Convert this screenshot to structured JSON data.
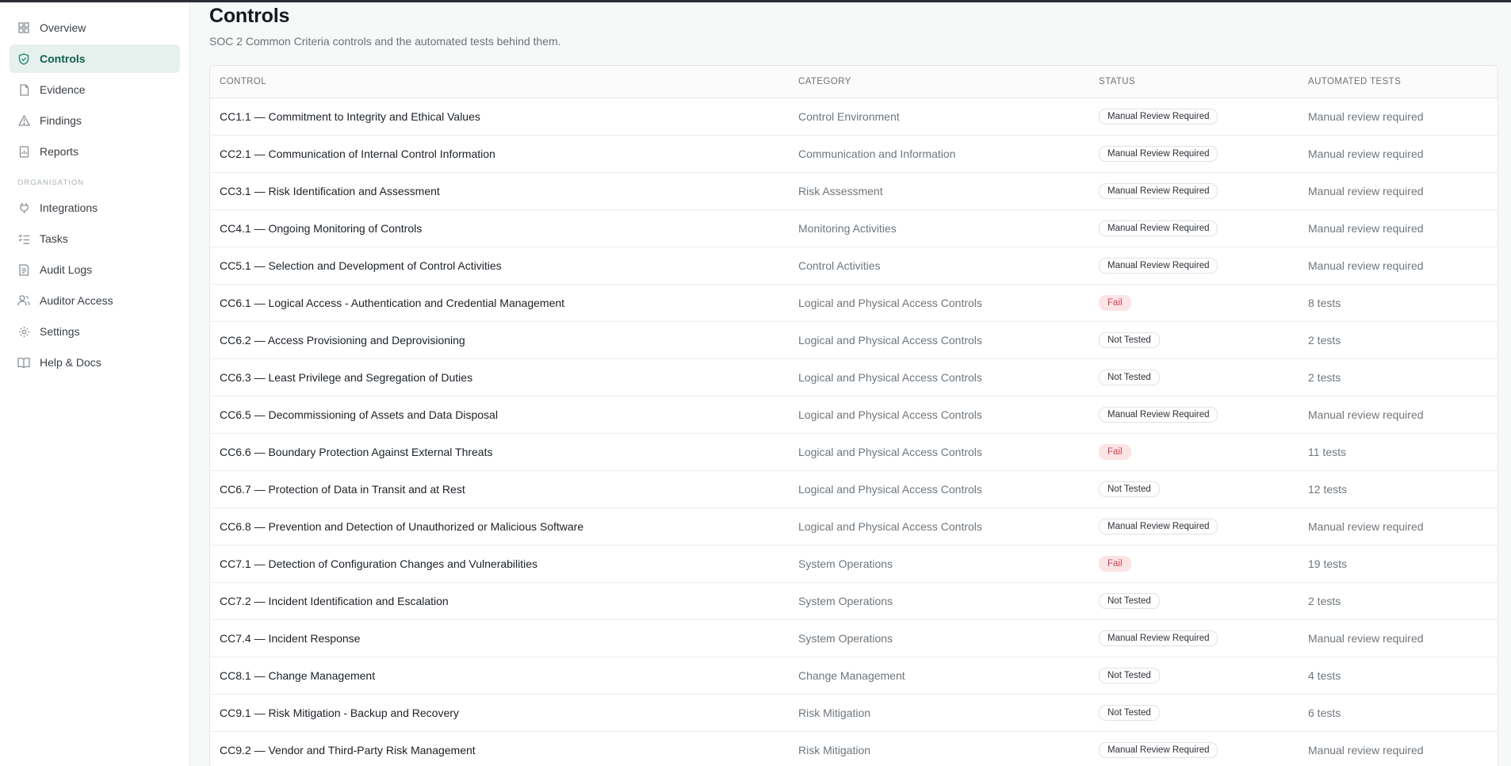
{
  "sidebar": {
    "items": [
      {
        "label": "Overview",
        "icon": "grid-icon"
      },
      {
        "label": "Controls",
        "icon": "shield-check-icon",
        "active": true
      },
      {
        "label": "Evidence",
        "icon": "file-icon"
      },
      {
        "label": "Findings",
        "icon": "alert-triangle-icon"
      },
      {
        "label": "Reports",
        "icon": "report-icon"
      }
    ],
    "section_label": "ORGANISATION",
    "org_items": [
      {
        "label": "Integrations",
        "icon": "plug-icon"
      },
      {
        "label": "Tasks",
        "icon": "list-check-icon"
      },
      {
        "label": "Audit Logs",
        "icon": "log-icon"
      },
      {
        "label": "Auditor Access",
        "icon": "users-icon"
      },
      {
        "label": "Settings",
        "icon": "gear-icon"
      },
      {
        "label": "Help & Docs",
        "icon": "book-icon"
      }
    ]
  },
  "page": {
    "title": "Controls",
    "subtitle": "SOC 2 Common Criteria controls and the automated tests behind them."
  },
  "table": {
    "headers": [
      "CONTROL",
      "CATEGORY",
      "STATUS",
      "AUTOMATED TESTS"
    ],
    "rows": [
      {
        "control": "CC1.1 — Commitment to Integrity and Ethical Values",
        "category": "Control Environment",
        "status": "Manual Review Required",
        "tests": "Manual review required"
      },
      {
        "control": "CC2.1 — Communication of Internal Control Information",
        "category": "Communication and Information",
        "status": "Manual Review Required",
        "tests": "Manual review required"
      },
      {
        "control": "CC3.1 — Risk Identification and Assessment",
        "category": "Risk Assessment",
        "status": "Manual Review Required",
        "tests": "Manual review required"
      },
      {
        "control": "CC4.1 — Ongoing Monitoring of Controls",
        "category": "Monitoring Activities",
        "status": "Manual Review Required",
        "tests": "Manual review required"
      },
      {
        "control": "CC5.1 — Selection and Development of Control Activities",
        "category": "Control Activities",
        "status": "Manual Review Required",
        "tests": "Manual review required"
      },
      {
        "control": "CC6.1 — Logical Access - Authentication and Credential Management",
        "category": "Logical and Physical Access Controls",
        "status": "Fail",
        "tests": "8 tests"
      },
      {
        "control": "CC6.2 — Access Provisioning and Deprovisioning",
        "category": "Logical and Physical Access Controls",
        "status": "Not Tested",
        "tests": "2 tests"
      },
      {
        "control": "CC6.3 — Least Privilege and Segregation of Duties",
        "category": "Logical and Physical Access Controls",
        "status": "Not Tested",
        "tests": "2 tests"
      },
      {
        "control": "CC6.5 — Decommissioning of Assets and Data Disposal",
        "category": "Logical and Physical Access Controls",
        "status": "Manual Review Required",
        "tests": "Manual review required"
      },
      {
        "control": "CC6.6 — Boundary Protection Against External Threats",
        "category": "Logical and Physical Access Controls",
        "status": "Fail",
        "tests": "11 tests"
      },
      {
        "control": "CC6.7 — Protection of Data in Transit and at Rest",
        "category": "Logical and Physical Access Controls",
        "status": "Not Tested",
        "tests": "12 tests"
      },
      {
        "control": "CC6.8 — Prevention and Detection of Unauthorized or Malicious Software",
        "category": "Logical and Physical Access Controls",
        "status": "Manual Review Required",
        "tests": "Manual review required"
      },
      {
        "control": "CC7.1 — Detection of Configuration Changes and Vulnerabilities",
        "category": "System Operations",
        "status": "Fail",
        "tests": "19 tests"
      },
      {
        "control": "CC7.2 — Incident Identification and Escalation",
        "category": "System Operations",
        "status": "Not Tested",
        "tests": "2 tests"
      },
      {
        "control": "CC7.4 — Incident Response",
        "category": "System Operations",
        "status": "Manual Review Required",
        "tests": "Manual review required"
      },
      {
        "control": "CC8.1 — Change Management",
        "category": "Change Management",
        "status": "Not Tested",
        "tests": "4 tests"
      },
      {
        "control": "CC9.1 — Risk Mitigation - Backup and Recovery",
        "category": "Risk Mitigation",
        "status": "Not Tested",
        "tests": "6 tests"
      },
      {
        "control": "CC9.2 — Vendor and Third-Party Risk Management",
        "category": "Risk Mitigation",
        "status": "Manual Review Required",
        "tests": "Manual review required"
      }
    ]
  },
  "colors": {
    "accent": "#1f8a70",
    "active_bg": "#e6f1ee",
    "fail_bg": "#fbe4e6",
    "fail_text": "#c8404f"
  }
}
